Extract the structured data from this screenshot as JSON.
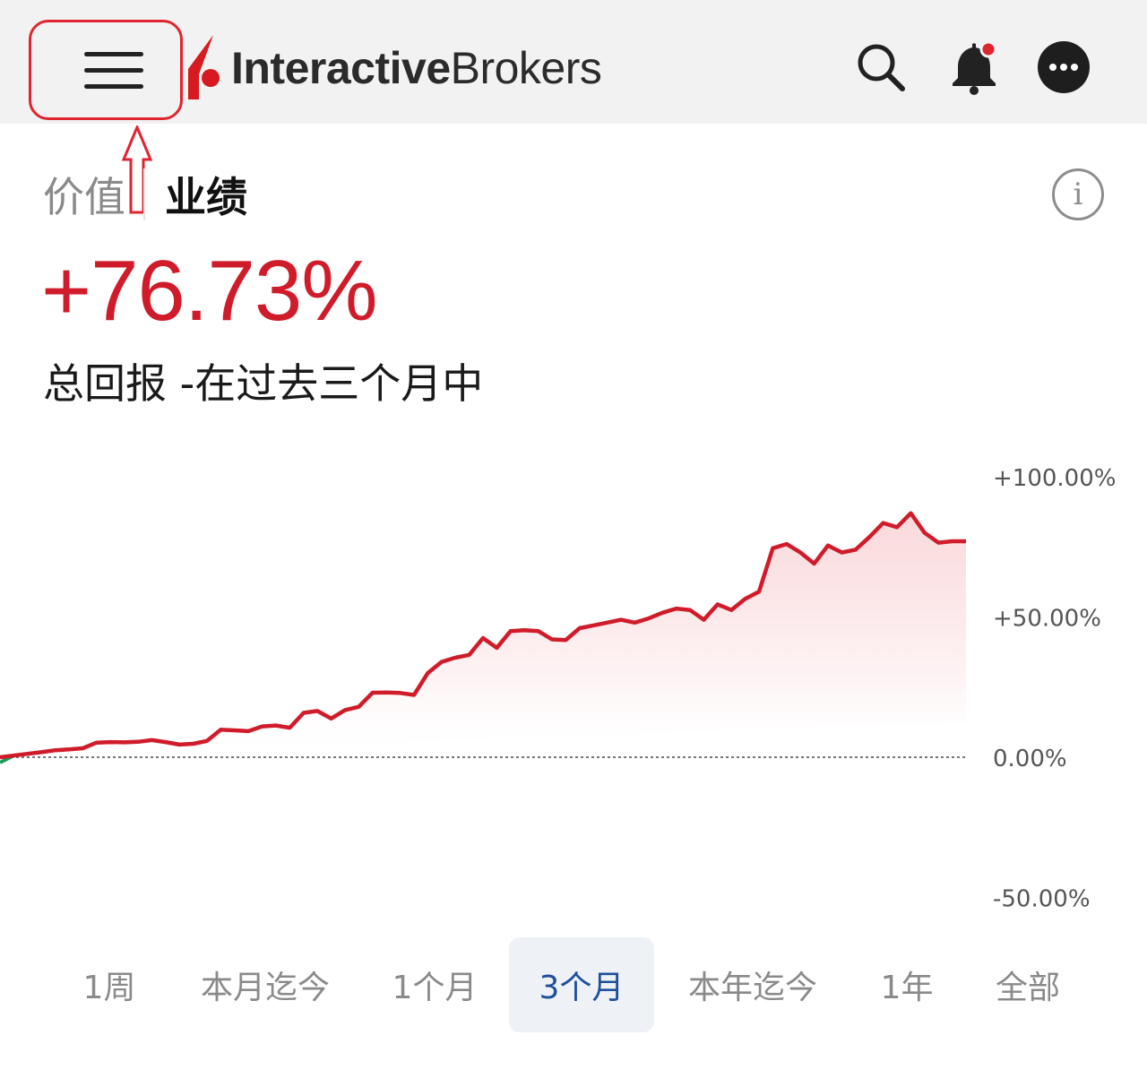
{
  "header": {
    "logo_bold": "Interactive",
    "logo_light": "Brokers",
    "brand_color": "#d71920",
    "icons": [
      "menu-icon",
      "search-icon",
      "bell-icon",
      "more-icon"
    ],
    "notification_dot_color": "#e0242f"
  },
  "tabs": [
    {
      "label": "价值",
      "active": false
    },
    {
      "label": "业绩",
      "active": true
    }
  ],
  "summary": {
    "total_return": "+76.73%",
    "caption": "总回报 -在过去三个月中",
    "return_color": "#d01c2a"
  },
  "chart_data": {
    "type": "area",
    "series_color": "#d01c2a",
    "baseline": 0,
    "ylim": [
      -60,
      110
    ],
    "yticks": [
      {
        "value": 100,
        "label": "+100.00%"
      },
      {
        "value": 50,
        "label": "+50.00%"
      },
      {
        "value": 0,
        "label": "0.00%"
      },
      {
        "value": -50,
        "label": "-50.00%"
      }
    ],
    "values": [
      0,
      0.6,
      1.2,
      1.8,
      2.5,
      2.8,
      3.2,
      5.2,
      5.4,
      5.3,
      5.5,
      6.1,
      5.4,
      4.5,
      4.8,
      5.8,
      9.8,
      9.6,
      9.3,
      11.0,
      11.3,
      10.5,
      15.8,
      16.5,
      13.8,
      16.8,
      18.0,
      23.0,
      23.1,
      22.9,
      22.2,
      30.0,
      34.0,
      35.5,
      36.5,
      42.5,
      39.0,
      45.0,
      45.3,
      45.0,
      42.0,
      41.8,
      46.0,
      47.0,
      48.0,
      49.0,
      48.0,
      49.5,
      51.5,
      53.0,
      52.5,
      49.0,
      54.5,
      52.5,
      56.5,
      59.0,
      74.5,
      76.0,
      73.0,
      69.0,
      75.5,
      73.0,
      74.0,
      78.5,
      83.5,
      82.0,
      87.0,
      80.0,
      76.5,
      77.0,
      77.0
    ]
  },
  "ranges": [
    {
      "label": "1周",
      "active": false
    },
    {
      "label": "本月迄今",
      "active": false
    },
    {
      "label": "1个月",
      "active": false
    },
    {
      "label": "3个月",
      "active": true
    },
    {
      "label": "本年迄今",
      "active": false
    },
    {
      "label": "1年",
      "active": false
    },
    {
      "label": "全部",
      "active": false
    }
  ]
}
